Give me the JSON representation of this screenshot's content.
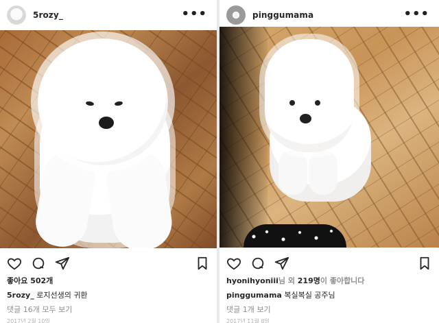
{
  "posts": [
    {
      "username": "5rozy_",
      "likes_text": "좋아요 502개",
      "caption_user": "5rozy_",
      "caption_text": "로지선생의 귀환",
      "comments_text": "댓글 16개 모두 보기",
      "date_text": "2017년 2월 10일"
    },
    {
      "username": "pinggumama",
      "liked_by_user": "hyonihyoniii",
      "liked_by_mid": "님 외 ",
      "liked_by_count": "219명",
      "liked_by_suffix": "이 좋아합니다",
      "caption_user": "pinggumama",
      "caption_text": "복실복실 공주님",
      "comments_text": "댓글 1개 보기",
      "date_text": "2017년 11월 8일"
    }
  ],
  "icons": {
    "heart": "heart-icon",
    "comment": "comment-icon",
    "share": "share-icon",
    "bookmark": "bookmark-icon",
    "more": "more-icon"
  },
  "colors": {
    "text": "#262626",
    "muted": "#8e8e8e",
    "background": "#ffffff"
  }
}
